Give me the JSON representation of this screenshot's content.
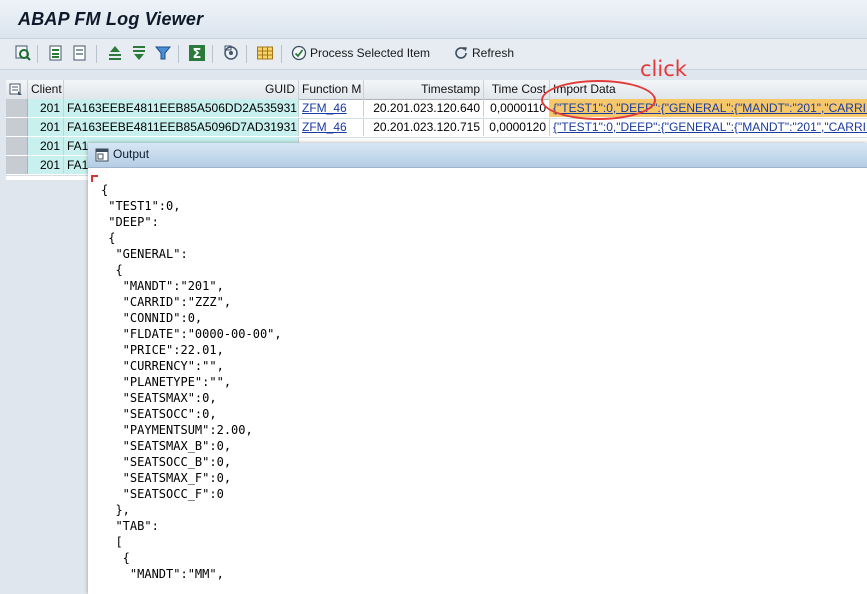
{
  "window": {
    "title": "ABAP FM Log Viewer"
  },
  "toolbar": {
    "process_label": "Process Selected Item",
    "refresh_label": "Refresh"
  },
  "grid": {
    "columns": [
      "Client",
      "GUID",
      "Function M",
      "Timestamp",
      "Time Cost",
      "Import Data"
    ],
    "rows": [
      {
        "client": "201",
        "guid": "FA163EEBE4811EEB85A506DD2A535931",
        "function": "ZFM_46",
        "timestamp": "20.201.023.120.640",
        "time_cost": "0,0000110",
        "import_data": "{\"TEST1\":0,\"DEEP\":{\"GENERAL\":{\"MANDT\":\"201\",\"CARRID\":\"ZZZ\""
      },
      {
        "client": "201",
        "guid": "FA163EEBE4811EEB85A5096D7AD31931",
        "function": "ZFM_46",
        "timestamp": "20.201.023.120.715",
        "time_cost": "0,0000120",
        "import_data": "{\"TEST1\":0,\"DEEP\":{\"GENERAL\":{\"MANDT\":\"201\",\"CARRID\":\"ZZZ\""
      },
      {
        "client": "201",
        "guid": "FA1",
        "function": "",
        "timestamp": "",
        "time_cost": "",
        "import_data": ""
      },
      {
        "client": "201",
        "guid": "FA1",
        "function": "",
        "timestamp": "",
        "time_cost": "",
        "import_data": ""
      }
    ]
  },
  "annotation": {
    "click_label": "click"
  },
  "popup": {
    "title": "Output",
    "lines": [
      "{",
      " \"TEST1\":0,",
      " \"DEEP\":",
      " {",
      "  \"GENERAL\":",
      "  {",
      "   \"MANDT\":\"201\",",
      "   \"CARRID\":\"ZZZ\",",
      "   \"CONNID\":0,",
      "   \"FLDATE\":\"0000-00-00\",",
      "   \"PRICE\":22.01,",
      "   \"CURRENCY\":\"\",",
      "   \"PLANETYPE\":\"\",",
      "   \"SEATSMAX\":0,",
      "   \"SEATSOCC\":0,",
      "   \"PAYMENTSUM\":2.00,",
      "   \"SEATSMAX_B\":0,",
      "   \"SEATSOCC_B\":0,",
      "   \"SEATSMAX_F\":0,",
      "   \"SEATSOCC_F\":0",
      "  },",
      "  \"TAB\":",
      "  [",
      "   {",
      "    \"MANDT\":\"MM\","
    ]
  },
  "colors": {
    "accent_red": "#e23a3a",
    "highlight": "#f7c86a",
    "key_column": "#c8f0ee",
    "link": "#1a3ba0"
  }
}
